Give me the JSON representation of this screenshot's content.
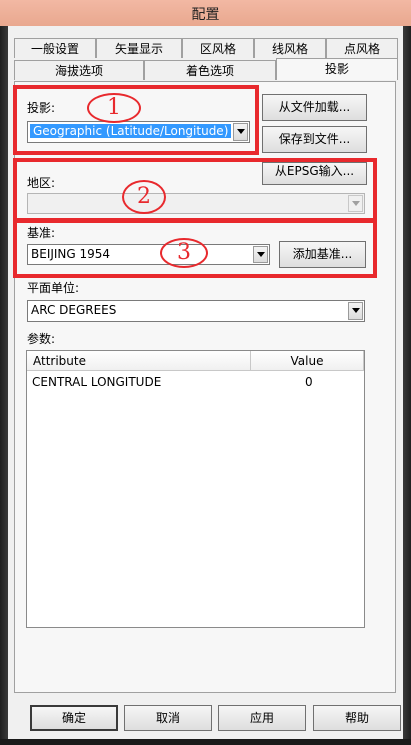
{
  "window": {
    "title": "配置"
  },
  "tabs_row1": [
    "一般设置",
    "矢量显示",
    "区风格",
    "线风格",
    "点风格"
  ],
  "tabs_row2": [
    "海拔选项",
    "着色选项",
    "投影"
  ],
  "projection": {
    "label": "投影:",
    "value": "Geographic (Latitude/Longitude)",
    "load_button": "从文件加载...",
    "save_button": "保存到文件...",
    "epsg_button": "从EPSG输入..."
  },
  "region": {
    "label": "地区:",
    "value": ""
  },
  "datum": {
    "label": "基准:",
    "value": "BEIJING 1954",
    "add_button": "添加基准..."
  },
  "plane_unit": {
    "label": "平面单位:",
    "value": "ARC DEGREES"
  },
  "params": {
    "label": "参数:",
    "columns": [
      "Attribute",
      "Value"
    ],
    "rows": [
      {
        "attribute": "CENTRAL LONGITUDE",
        "value": "0"
      }
    ]
  },
  "annotations": [
    "1",
    "2",
    "3"
  ],
  "annotation_color": "#e8292d",
  "buttons": {
    "ok": "确定",
    "cancel": "取消",
    "apply": "应用",
    "help": "帮助"
  }
}
